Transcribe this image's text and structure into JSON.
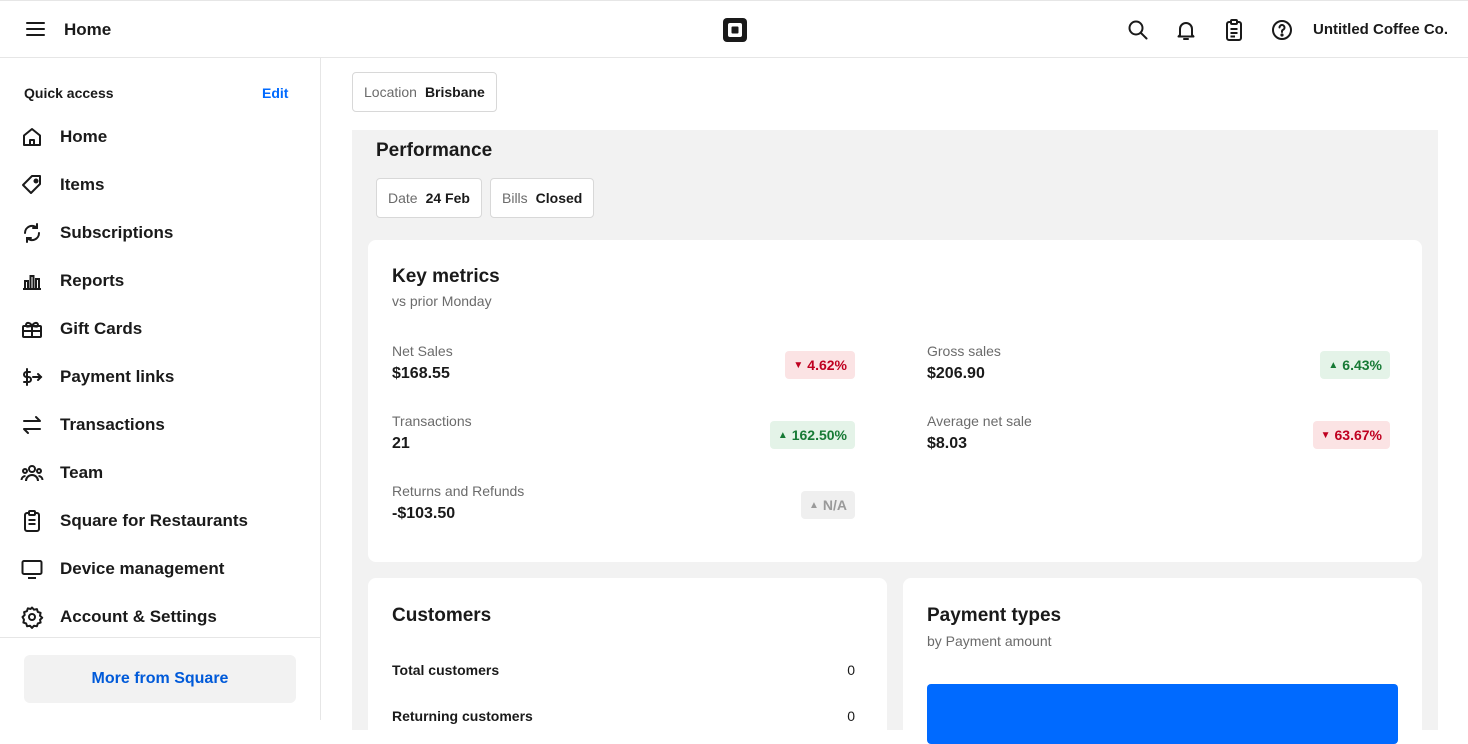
{
  "topbar": {
    "title": "Home",
    "account_name": "Untitled Coffee Co.",
    "icons": [
      "menu-icon",
      "square-logo",
      "search-icon",
      "bell-icon",
      "clipboard-icon",
      "help-icon"
    ]
  },
  "sidebar": {
    "quick_access_title": "Quick access",
    "edit_label": "Edit",
    "items": [
      {
        "label": "Home",
        "icon": "home-icon"
      },
      {
        "label": "Items",
        "icon": "tag-icon"
      },
      {
        "label": "Subscriptions",
        "icon": "refresh-icon"
      },
      {
        "label": "Reports",
        "icon": "bar-chart-icon"
      },
      {
        "label": "Gift Cards",
        "icon": "gift-icon"
      },
      {
        "label": "Payment links",
        "icon": "payment-link-icon"
      },
      {
        "label": "Transactions",
        "icon": "transfer-icon"
      },
      {
        "label": "Team",
        "icon": "team-icon"
      },
      {
        "label": "Square for Restaurants",
        "icon": "restaurant-icon"
      },
      {
        "label": "Device management",
        "icon": "monitor-icon"
      },
      {
        "label": "Account & Settings",
        "icon": "gear-icon"
      }
    ],
    "more_button": "More from Square"
  },
  "filters": {
    "location_label": "Location",
    "location_value": "Brisbane",
    "date_label": "Date",
    "date_value": "24 Feb",
    "bills_label": "Bills",
    "bills_value": "Closed"
  },
  "performance": {
    "title": "Performance",
    "key_metrics": {
      "title": "Key metrics",
      "subtitle": "vs prior Monday",
      "metrics": [
        {
          "label": "Net Sales",
          "value": "$168.55",
          "change": "4.62%",
          "trend": "down"
        },
        {
          "label": "Gross sales",
          "value": "$206.90",
          "change": "6.43%",
          "trend": "up"
        },
        {
          "label": "Transactions",
          "value": "21",
          "change": "162.50%",
          "trend": "up"
        },
        {
          "label": "Average net sale",
          "value": "$8.03",
          "change": "63.67%",
          "trend": "down"
        },
        {
          "label": "Returns and Refunds",
          "value": "-$103.50",
          "change": "N/A",
          "trend": "na"
        }
      ]
    },
    "customers": {
      "title": "Customers",
      "rows": [
        {
          "label": "Total customers",
          "value": "0"
        },
        {
          "label": "Returning customers",
          "value": "0"
        }
      ]
    },
    "payment_types": {
      "title": "Payment types",
      "subtitle": "by Payment amount"
    }
  },
  "colors": {
    "accent": "#006aff",
    "positive": "#177a35",
    "negative": "#bf0020",
    "panel_bg": "#f2f2f2"
  }
}
